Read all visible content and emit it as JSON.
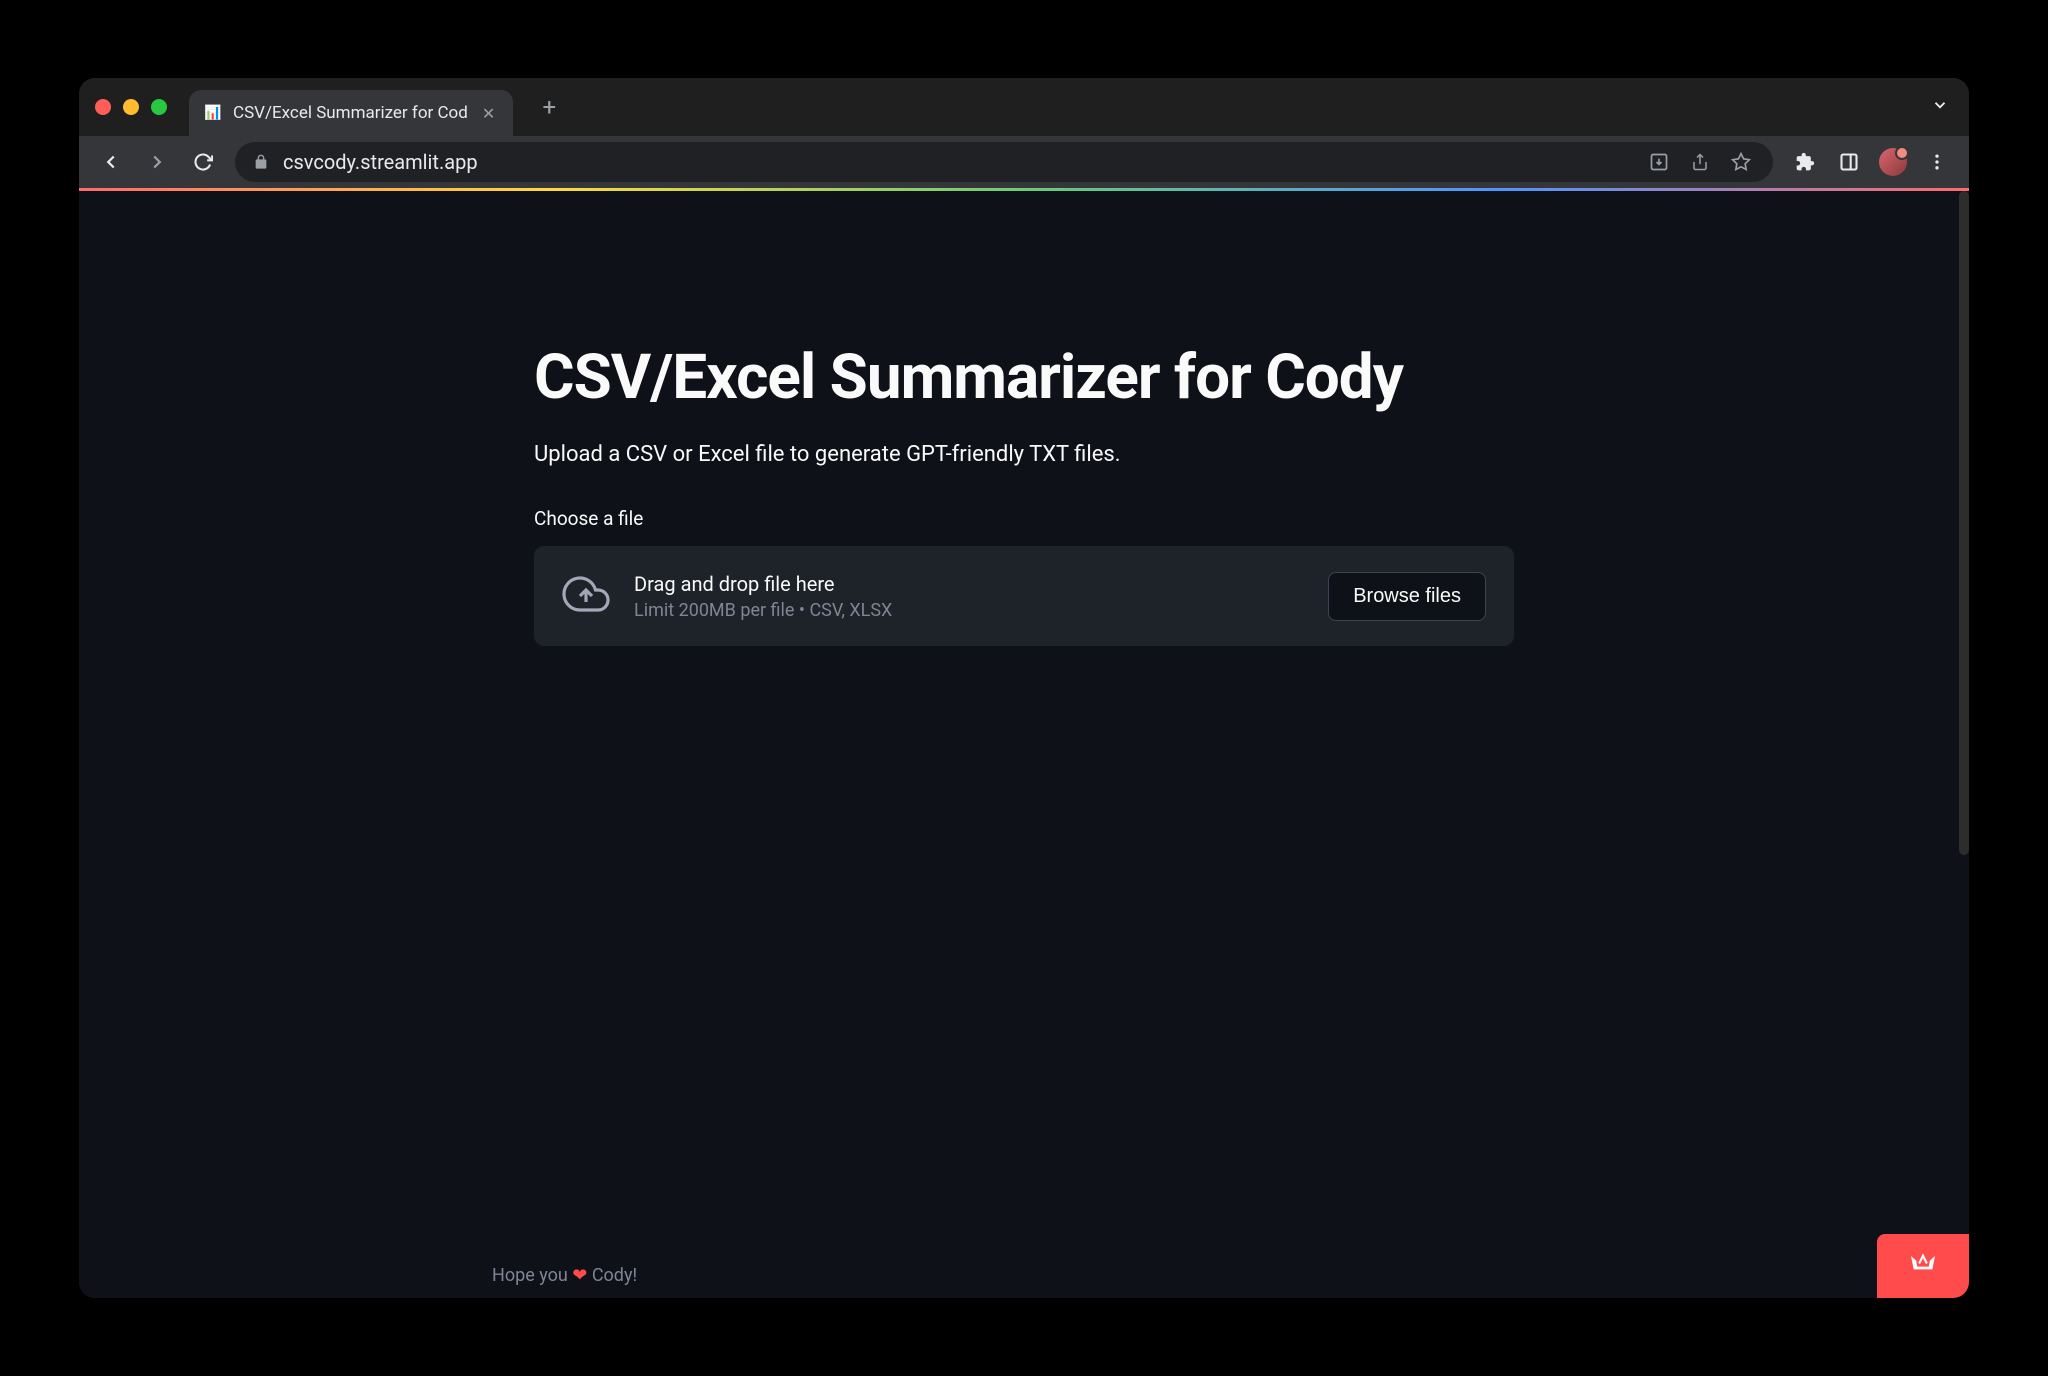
{
  "browser": {
    "tab_title": "CSV/Excel Summarizer for Cod",
    "tab_favicon": "📊",
    "url": "csvcody.streamlit.app"
  },
  "app": {
    "title": "CSV/Excel Summarizer for Cody",
    "subtitle": "Upload a CSV or Excel file to generate GPT-friendly TXT files.",
    "choose_label": "Choose a file",
    "upload": {
      "main_text": "Drag and drop file here",
      "sub_text": "Limit 200MB per file • CSV, XLSX",
      "browse_button": "Browse files"
    },
    "footer_prefix": "Hope you ",
    "footer_heart": "❤",
    "footer_suffix": " Cody!"
  },
  "colors": {
    "page_bg": "#0e1117",
    "upload_bg": "#1e2229",
    "accent": "#ff4b4b"
  }
}
